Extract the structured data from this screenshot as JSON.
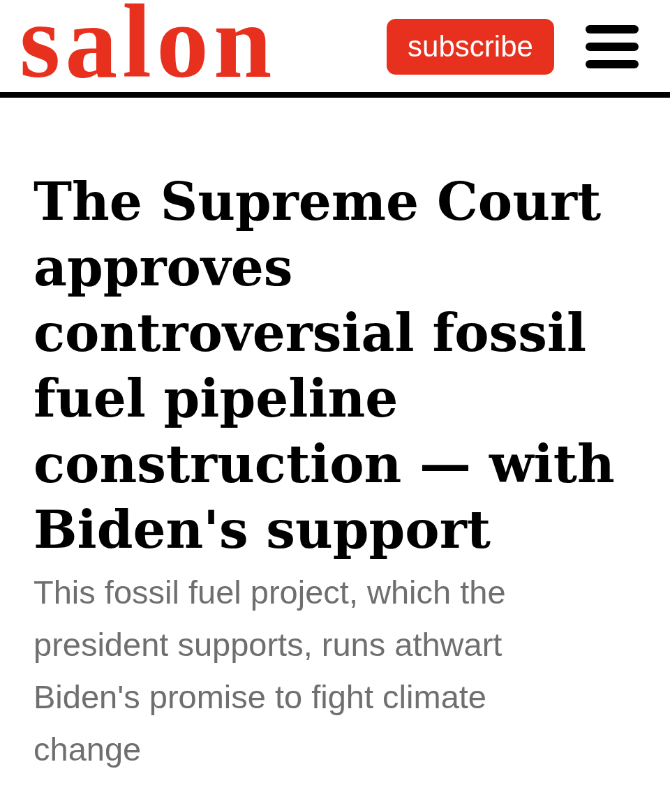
{
  "header": {
    "logo": "salon",
    "subscribe_button": "subscribe"
  },
  "article": {
    "headline": "The Supreme Court approves controversial fossil fuel pipeline construction — with Biden's support",
    "dek": "This fossil fuel project, which the president supports, runs athwart Biden's promise to fight climate change"
  }
}
